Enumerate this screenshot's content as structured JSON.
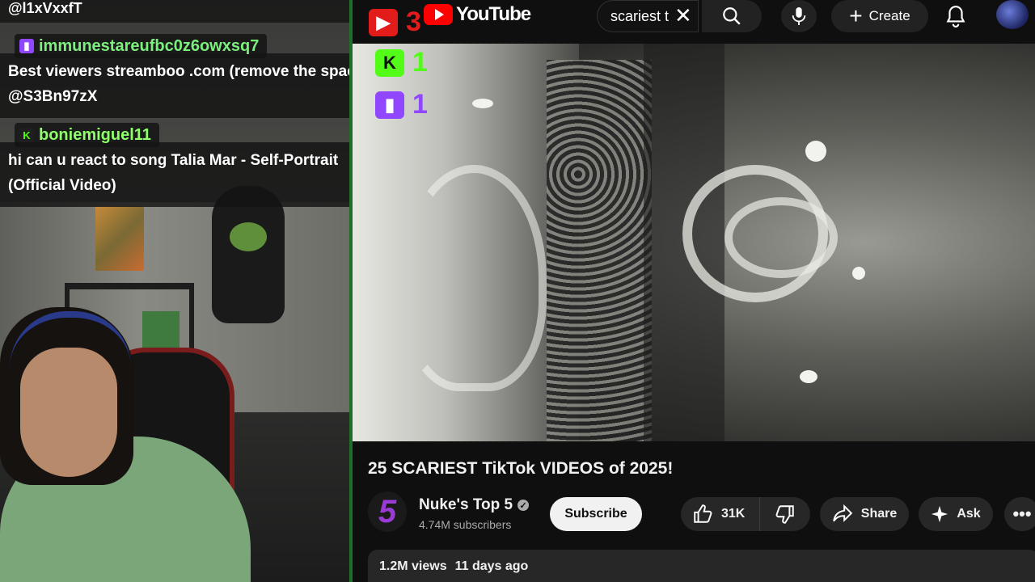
{
  "chat": {
    "top_line": "@l1xVxxfT",
    "messages": [
      {
        "user": "immunestareufbc0z6owxsq7",
        "platform": "twitch",
        "user_color": "#7cf07c",
        "lines": [
          "Best viewers streamboo .com (remove the space)",
          "@S3Bn97zX"
        ]
      },
      {
        "user": "boniemiguel11",
        "platform": "kick",
        "user_color": "#8fff6a",
        "lines": [
          "hi can u react to song Talia Mar - Self-Portrait",
          "(Official Video)"
        ]
      }
    ]
  },
  "counters": {
    "youtube": "3",
    "kick": "1",
    "twitch": "1",
    "youtube_color": "#e21b1b",
    "kick_color": "#53fc18",
    "twitch_color": "#9146ff"
  },
  "youtube": {
    "logo_text": "YouTube",
    "search_value": "scariest t",
    "create_label": "Create",
    "video_title": "25 SCARIEST TikTok VIDEOS of 2025!",
    "channel": {
      "name": "Nuke's Top 5",
      "subscribers": "4.74M subscribers",
      "logo_glyph": "5"
    },
    "subscribe_label": "Subscribe",
    "likes": "31K",
    "share_label": "Share",
    "ask_label": "Ask",
    "views": "1.2M views",
    "uploaded": "11 days ago"
  },
  "icons": {
    "search": "search-icon",
    "mic": "mic-icon",
    "bell": "bell-icon",
    "like": "thumbs-up-icon",
    "dislike": "thumbs-down-icon",
    "share": "share-icon",
    "ask": "sparkle-icon",
    "more": "more-icon"
  },
  "colors": {
    "youtube_red": "#ff0000",
    "divider_green": "#1f6f2a",
    "background": "#0f0f0f"
  }
}
